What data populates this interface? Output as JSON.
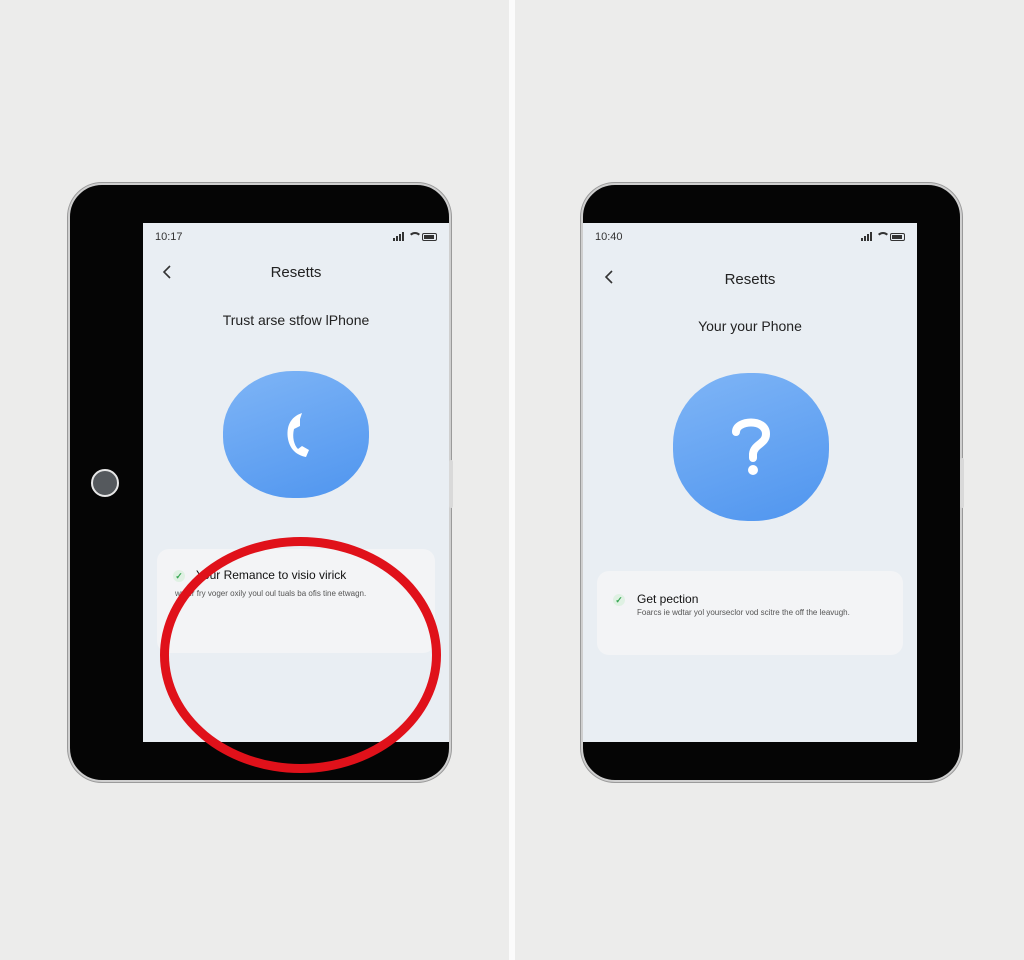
{
  "left": {
    "status_time": "10:17",
    "title": "Resetts",
    "subtitle": "Trust arse stfow lPhone",
    "card": {
      "title": "Your Remance to visio virick",
      "body": "writer fry voger oxily youl oul tuals ba ofis tine etwagn."
    }
  },
  "right": {
    "status_time": "10:40",
    "title": "Resetts",
    "subtitle": "Your your Phone",
    "card": {
      "title": "Get pection",
      "body": "Foarcs ie wdtar yol yourseclor vod scitre the off the leavugh."
    }
  },
  "icons": {
    "back": "chevron-left-icon",
    "left_tile": "phone-icon",
    "right_tile": "question-icon",
    "check": "check-icon"
  },
  "colors": {
    "highlight": "#e0111a",
    "tile_blue": "#5b9ef0",
    "check_green": "#37a653"
  }
}
